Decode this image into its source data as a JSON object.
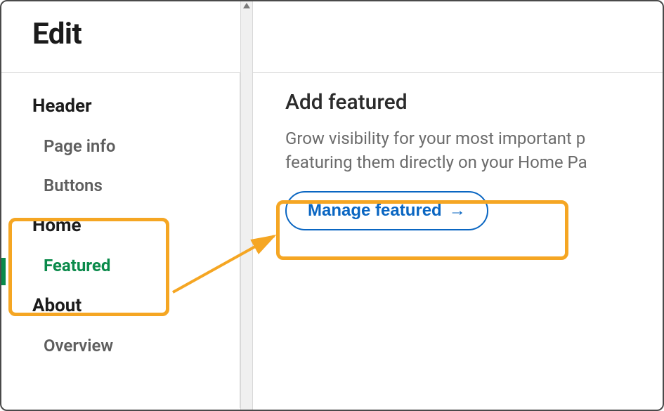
{
  "title": "Edit",
  "sidebar": {
    "sections": [
      {
        "label": "Header",
        "items": [
          {
            "label": "Page info"
          },
          {
            "label": "Buttons"
          }
        ]
      },
      {
        "label": "Home",
        "items": [
          {
            "label": "Featured",
            "active": true
          }
        ]
      },
      {
        "label": "About",
        "items": [
          {
            "label": "Overview"
          }
        ]
      }
    ]
  },
  "main": {
    "heading": "Add featured",
    "description_line1": "Grow visibility for your most important p",
    "description_line2": "featuring them directly on your Home Pa",
    "button_label": "Manage featured"
  }
}
